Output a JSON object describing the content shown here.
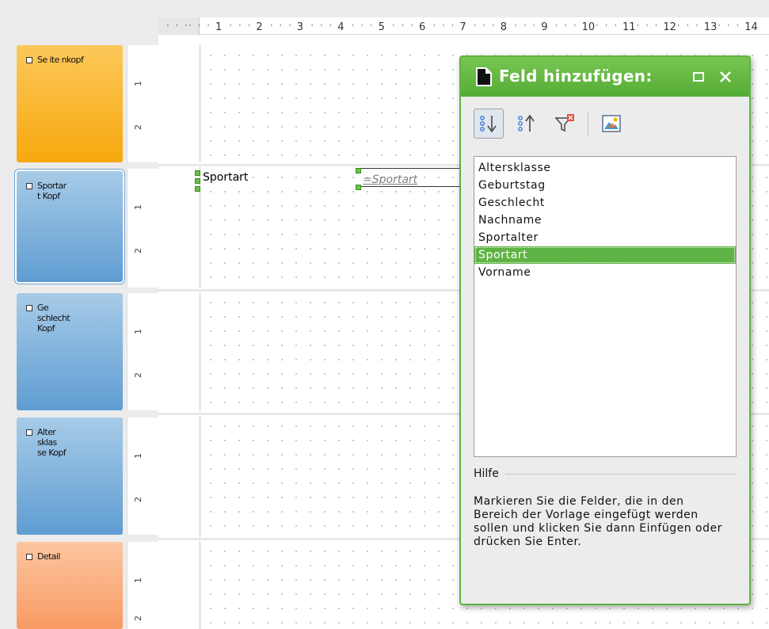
{
  "ruler": {
    "numbers": [
      "1",
      "2",
      "3",
      "4",
      "5",
      "6",
      "7",
      "8",
      "9",
      "10",
      "11",
      "12",
      "13",
      "14"
    ]
  },
  "sections": [
    {
      "label": "Se ite nkopf",
      "theme": "orange"
    },
    {
      "label": "Sportar\nt Kopf",
      "theme": "blue-selected"
    },
    {
      "label": "Ge\nschlecht\nKopf",
      "theme": "blue"
    },
    {
      "label": "Alter\nsklas\nse Kopf",
      "theme": "blue"
    },
    {
      "label": "Detail",
      "theme": "detail"
    }
  ],
  "vruler_marks": [
    "1",
    "2"
  ],
  "report": {
    "label_field": "Sportart",
    "data_field": "=Sportart"
  },
  "dialog": {
    "title": "Feld hinzufügen:",
    "fields": [
      "Altersklasse",
      "Geburtstag",
      "Geschlecht",
      "Nachname",
      "Sportalter",
      "Sportart",
      "Vorname"
    ],
    "selected_index": 5,
    "help_heading": "Hilfe",
    "help_text": "Markieren Sie die Felder, die in den Bereich der Vorlage eingefügt werden sollen und klicken Sie dann Einfügen oder drücken Sie Enter.",
    "toolbar_icons": [
      "sort-ascending-icon",
      "sort-descending-icon",
      "remove-filter-icon",
      "insert-image-icon"
    ]
  },
  "colors": {
    "accent_green": "#5fb344",
    "section_orange": "#f7a80e",
    "section_blue": "#5f9dd2",
    "section_detail": "#f99a63"
  }
}
